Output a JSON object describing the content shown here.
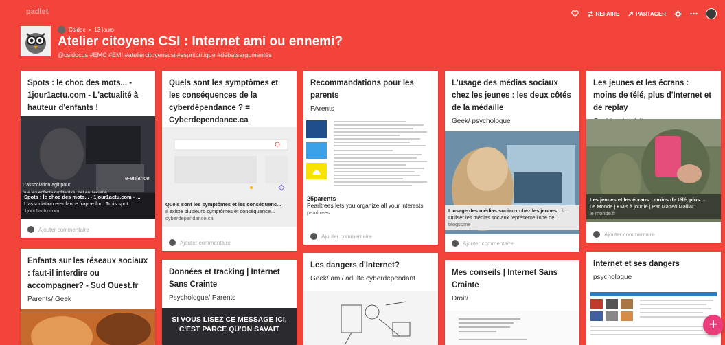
{
  "app": {
    "brand": "padlet",
    "actions": {
      "remix": "REFAIRE",
      "share": "PARTAGER"
    },
    "icons": [
      "heart-icon",
      "remix-icon",
      "share-icon",
      "gear-icon",
      "more-icon"
    ]
  },
  "header": {
    "author": "Csidoc",
    "time": "13 jours",
    "title": "Atelier citoyens CSI : Internet ami ou ennemi?",
    "hashtags": "@csidocus #EMC #EMI #ateliercitoyenscsi #espritcritique #débatsargumentés"
  },
  "comment_label": "Ajouter commentaire",
  "cards": {
    "c1": {
      "title": "Spots : le choc des mots... - 1jour1actu.com - L'actualité à hauteur d'enfants !",
      "img_text1": "Spots : le choc des mots",
      "img_text2": "L'association agit pour",
      "img_text3": "que les enfants profitent du net en sécurité",
      "img_text4": "e-enfance",
      "cap_title": "Spots : le choc des mots... - 1jour1actu.com - ...",
      "cap_desc": "L'association e-enfance frappe fort. Trois spot...",
      "cap_src": "1jour1actu.com"
    },
    "c2": {
      "title": "Enfants sur les réseaux sociaux : faut-il interdire ou accompagner? - Sud Ouest.fr",
      "sub": "Parents/ Geek"
    },
    "c3": {
      "title": "Quels sont les symptômes et les conséquences de la cyberdépendance ? = Cyberdependance.ca",
      "cap_title": "Quels sont les symptômes et les conséquenc...",
      "cap_desc": "Il existe plusieurs symptômes et conséquence...",
      "cap_src": "cyberdependance.ca"
    },
    "c4": {
      "title": "Données et tracking | Internet Sans Crainte",
      "sub": "Psychologue/ Parents",
      "img_line1": "SI VOUS LISEZ CE MESSAGE ICI,",
      "img_line2": "C'EST PARCE QU'ON SAVAIT"
    },
    "c5": {
      "title": "Recommandations pour les parents",
      "sub": "PArents",
      "cap_title": "25parents",
      "cap_desc": "Pearltrees lets you organize all your interests",
      "cap_src": "pearltrees"
    },
    "c6": {
      "title": "Les dangers d'Internet?",
      "sub": "Geek/ ami/ adulte cyberdependant"
    },
    "c7": {
      "title": "L'usage des médias sociaux chez les jeunes : les deux côtés de la médaille",
      "sub": "Geek/ psychologue",
      "cap_title": "L'usage des médias sociaux chez les jeunes : l...",
      "cap_desc": "Utiliser les médias sociaux représente l'une de...",
      "cap_src": "blogspme"
    },
    "c8": {
      "title": "Mes conseils | Internet Sans Crainte",
      "sub": "Droit/"
    },
    "c9": {
      "title": "Les jeunes et les écrans : moins de télé, plus d'Internet et de replay",
      "sub": "Geek/ ami /adulte",
      "cap_title": "Les jeunes et les écrans : moins de télé, plus ...",
      "cap_desc": "Le Monde | • Mis à jour le | Par Matteo Maillar...",
      "cap_src": "le monde.fr"
    },
    "c10": {
      "title": "Internet et ses dangers",
      "sub": "psychologue"
    }
  },
  "fab_label": "+",
  "colors": {
    "background": "#f2443a",
    "fab": "#ea3d7a",
    "card": "#ffffff"
  }
}
